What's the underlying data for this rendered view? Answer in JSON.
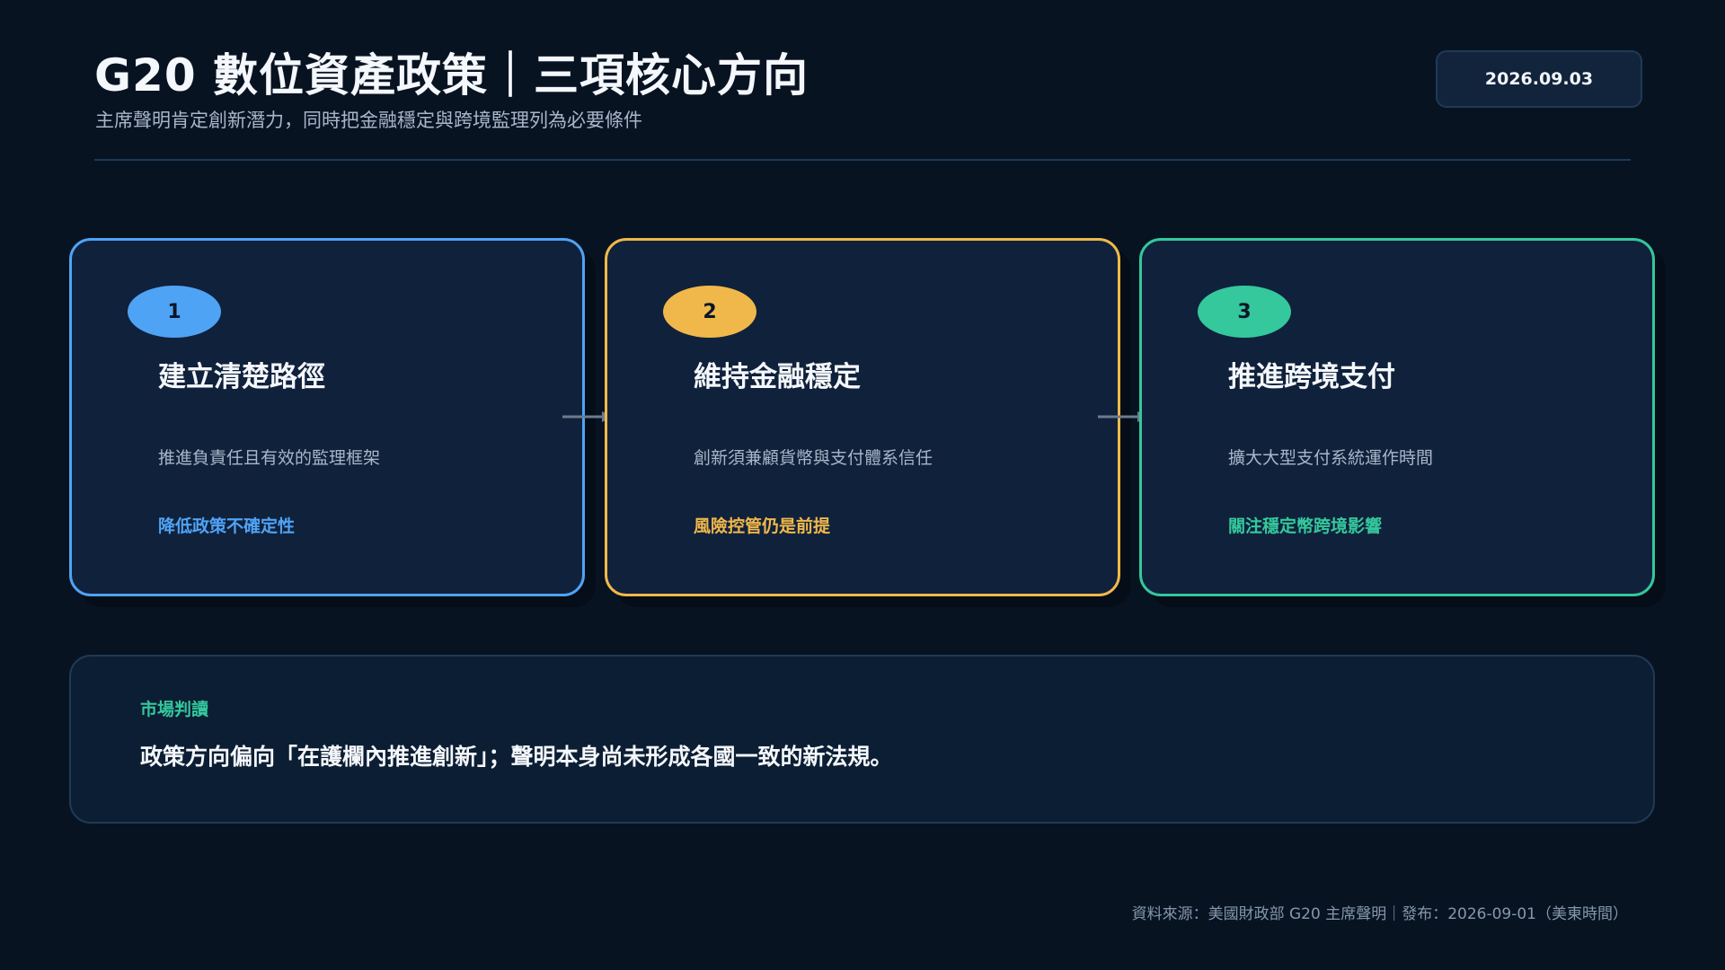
{
  "header": {
    "title": "G20 數位資產政策｜三項核心方向",
    "subtitle": "主席聲明肯定創新潛力，同時把金融穩定與跨境監理列為必要條件",
    "date": "2026.09.03"
  },
  "cards": [
    {
      "number": "1",
      "title": "建立清楚路徑",
      "description": "推進負責任且有效的監理框架",
      "note": "降低政策不確定性",
      "accent_color": "#4fa3f5"
    },
    {
      "number": "2",
      "title": "維持金融穩定",
      "description": "創新須兼顧貨幣與支付體系信任",
      "note": "風險控管仍是前提",
      "accent_color": "#f0b84b"
    },
    {
      "number": "3",
      "title": "推進跨境支付",
      "description": "擴大大型支付系統運作時間",
      "note": "關注穩定幣跨境影響",
      "accent_color": "#34c89c"
    }
  ],
  "market": {
    "label": "市場判讀",
    "text": "政策方向偏向「在護欄內推進創新」；聲明本身尚未形成各國一致的新法規。"
  },
  "footer": {
    "source": "資料來源：美國財政部 G20 主席聲明｜發布：2026-09-01（美東時間）"
  },
  "icons": {
    "connector": "arrow-right-icon"
  },
  "colors": {
    "background": "#081322",
    "card_background": "#10213b",
    "blue": "#4fa3f5",
    "yellow": "#f0b84b",
    "green": "#34c89c"
  }
}
